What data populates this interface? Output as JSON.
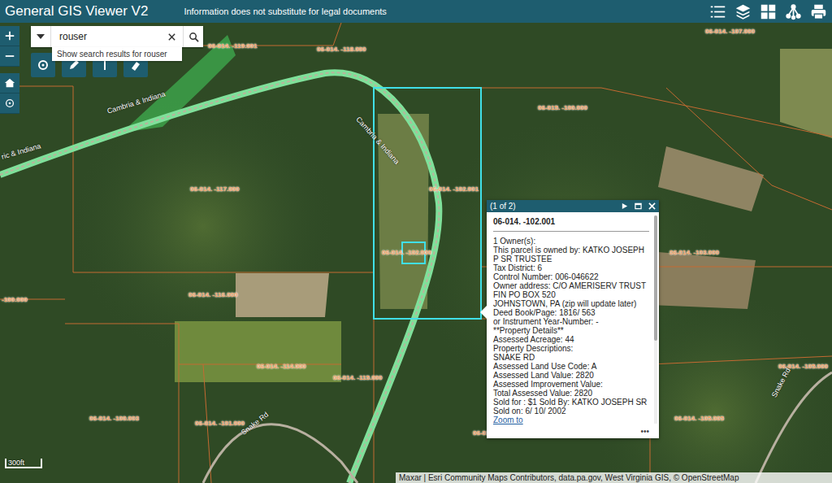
{
  "header": {
    "title": "General GIS Viewer V2",
    "disclaimer": "Information does not substitute for legal documents"
  },
  "search": {
    "value": "rouser",
    "suggestion": "Show search results for rouser"
  },
  "parcel_labels": [
    "06-014. -107.000",
    "06-014. -119.001",
    "06-014. -118.000",
    "002",
    "06-015. -100.000",
    "06-014. -117.000",
    "06-014. -102.001",
    "06-014. -102.000",
    "06-014. -103.000",
    "06-014. -116.000",
    "-100.000",
    "06-014. -114.000",
    "06-014. -115.000",
    "06-014. -105.000",
    "06-014. -100.003",
    "06-014. -101.000",
    "06-014. -105.005",
    "06-014. -103.001"
  ],
  "road_labels": [
    "Cambria & Indiana",
    "Cambria & Indiana",
    "ric & Indiana",
    "Snake Rd",
    "Snake Rd"
  ],
  "popup": {
    "counter": "(1 of 2)",
    "title": "06-014. -102.001",
    "lines": [
      "1 Owner(s):",
      "This parcel is owned by: KATKO JOSEPH P SR TRUSTEE",
      "Tax District: 6",
      "Control Number: 006-046622",
      "Owner address: C/O AMERISERV TRUST FIN PO BOX 520",
      "JOHNSTOWN, PA (zip will update later)",
      "Deed Book/Page: 1816/ 563",
      "or Instrument Year-Number: -",
      "**Property Details**",
      "Assessed Acreage: 44",
      "Property Descriptions:",
      "SNAKE RD",
      "Assessed Land Use Code: A",
      "Assessed Land Value: 2820",
      "Assessed Improvement Value:",
      "Total Assessed Value: 2820",
      "Sold for : $1 Sold By: KATKO JOSEPH SR",
      "Sold on: 6/ 10/ 2002"
    ],
    "link": "Zoom to",
    "more": "•••"
  },
  "scale": "300ft",
  "attribution": "Maxar | Esri Community Maps Contributors, data.pa.gov, West Virginia GIS, © OpenStreetMap"
}
